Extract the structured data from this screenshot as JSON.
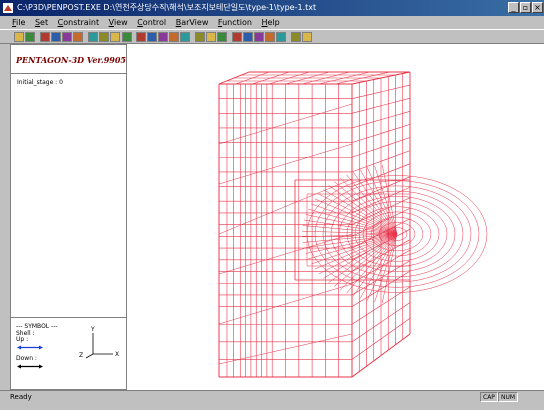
{
  "window": {
    "title": "C:\\P3D\\PENPOST.EXE   D:\\연천주상당수직\\해석\\보조지보테단일도\\type-1\\type-1.txt",
    "minimize": "_",
    "maximize": "▫",
    "close": "×"
  },
  "menu": {
    "items": [
      "File",
      "Set",
      "Constraint",
      "View",
      "Control",
      "BarView",
      "Function",
      "Help"
    ]
  },
  "panel": {
    "brand": "PENTAGON-3D Ver.9905",
    "stage_label": "Initial_stage :  0",
    "symbol_header": "--- SYMBOL ---",
    "shell_label": "Shell :",
    "up_label": "Up :",
    "down_label": "Down :",
    "axis_x": "X",
    "axis_y": "Y",
    "axis_z": "Z"
  },
  "status": {
    "text": "Ready",
    "cap": "CAP",
    "num": "NUM"
  },
  "colors": {
    "mesh": "#e8344a",
    "arrow_up": "#1a3fd6",
    "arrow_down": "#000000",
    "brand": "#7a0000",
    "title_bar": "#0a246a"
  },
  "icons": {
    "toolbar": [
      "open-icon",
      "tool-icon",
      "pencil-icon",
      "constraint-icon",
      "view-icon",
      "grid-icon",
      "barview-icon",
      "palette-icon",
      "function-icon",
      "zoom-icon",
      "rotate-icon",
      "pan-icon",
      "reset-icon",
      "move-icon",
      "fit-icon",
      "zoom-in-icon",
      "zoom-out-icon",
      "select-icon",
      "layer-icon",
      "render-icon",
      "mesh-icon",
      "print-icon",
      "export-icon",
      "info-icon",
      "help-icon"
    ]
  }
}
